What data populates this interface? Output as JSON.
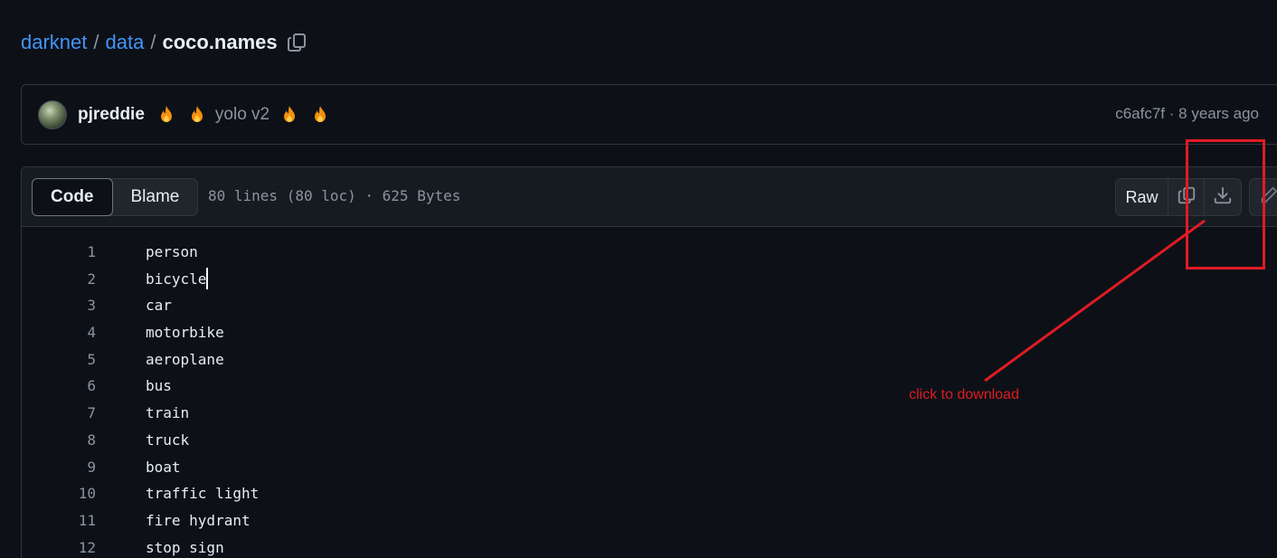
{
  "breadcrumb": {
    "repo": "darknet",
    "sep1": "/",
    "folder": "data",
    "sep2": "/",
    "file": "coco.names"
  },
  "commit": {
    "author": "pjreddie",
    "message": "yolo v2",
    "hash": "c6afc7f",
    "separator": "·",
    "age": "8 years ago",
    "emoji_icons": [
      "fire-icon",
      "fire-icon",
      "fire-icon",
      "fire-icon"
    ]
  },
  "file_header": {
    "code_label": "Code",
    "blame_label": "Blame",
    "info": "80 lines (80 loc) · 625 Bytes",
    "raw_label": "Raw"
  },
  "lines": [
    {
      "num": "1",
      "text": "person"
    },
    {
      "num": "2",
      "text": "bicycle"
    },
    {
      "num": "3",
      "text": "car"
    },
    {
      "num": "4",
      "text": "motorbike"
    },
    {
      "num": "5",
      "text": "aeroplane"
    },
    {
      "num": "6",
      "text": "bus"
    },
    {
      "num": "7",
      "text": "train"
    },
    {
      "num": "8",
      "text": "truck"
    },
    {
      "num": "9",
      "text": "boat"
    },
    {
      "num": "10",
      "text": "traffic light"
    },
    {
      "num": "11",
      "text": "fire hydrant"
    },
    {
      "num": "12",
      "text": "stop sign"
    }
  ],
  "annotation": {
    "text": "click to download",
    "color": "#e01b24"
  },
  "colors": {
    "background": "#0d1117",
    "link": "#4493f8",
    "muted": "#8b949e",
    "border": "#30363d"
  }
}
